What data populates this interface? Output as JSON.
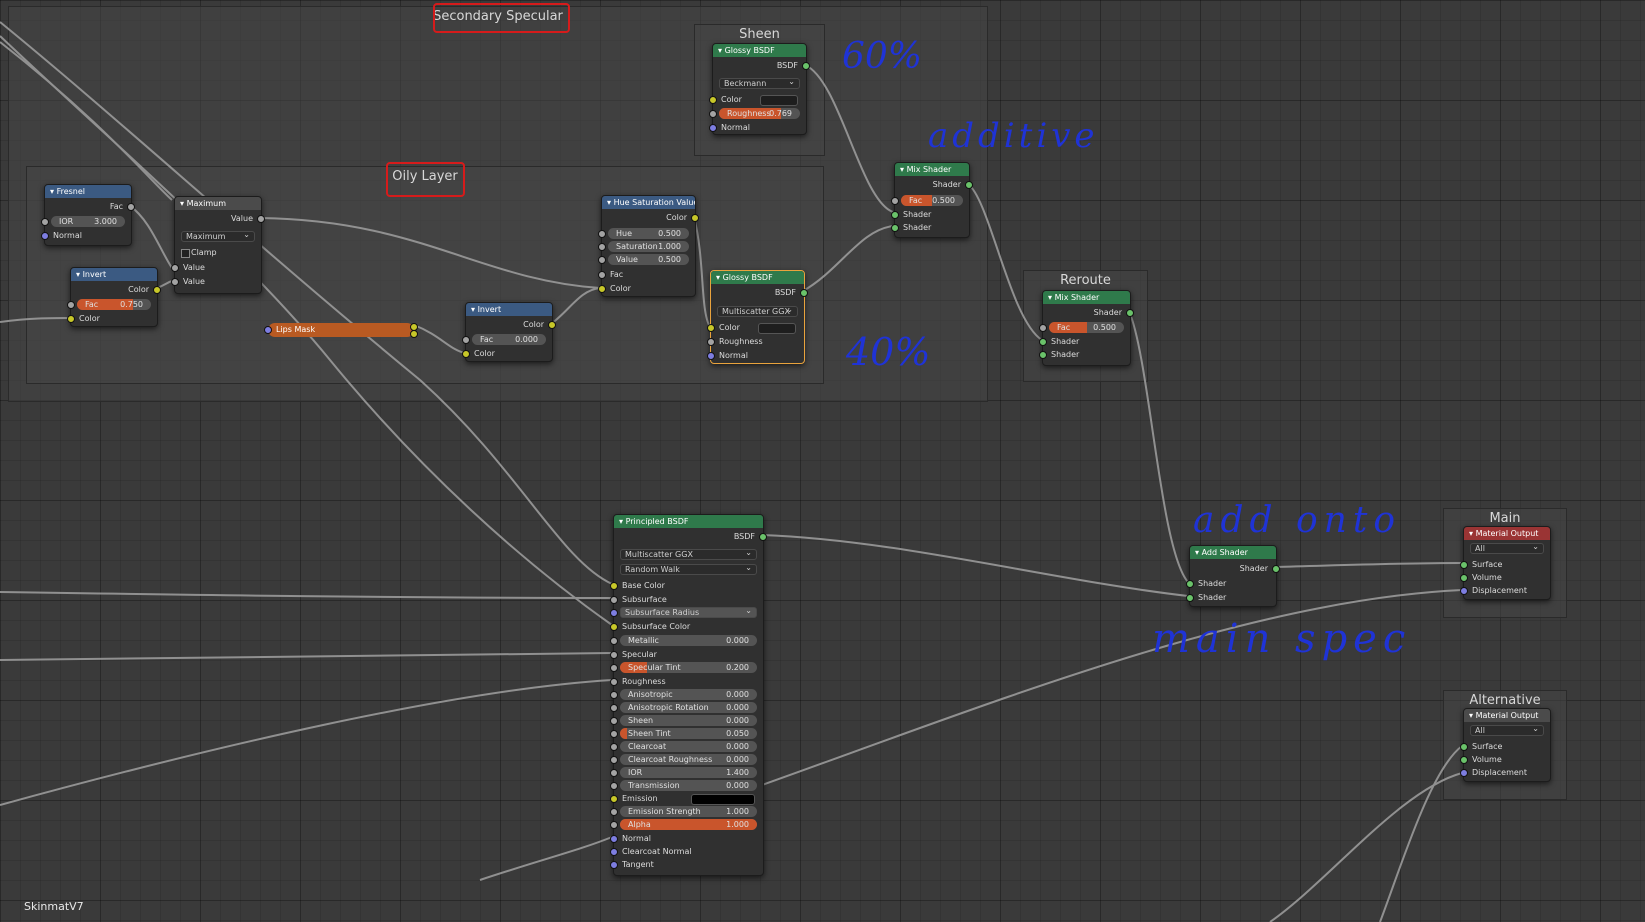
{
  "frames": {
    "secondary_specular": "Secondary Specular",
    "oily_layer": "Oily Layer",
    "sheen": "Sheen",
    "reroute": "Reroute",
    "main": "Main",
    "alternative": "Alternative"
  },
  "annotations": {
    "sixty": "60%",
    "forty": "40%",
    "additive": "additive",
    "add_onto": "add onto",
    "main_spec": "main spec"
  },
  "nodes": {
    "fresnel": {
      "title": "Fresnel",
      "fac": "Fac",
      "ior_label": "IOR",
      "ior_value": "3.000",
      "normal": "Normal"
    },
    "maximum": {
      "title": "Maximum",
      "value_out": "Value",
      "mode": "Maximum",
      "clamp": "Clamp",
      "value1": "Value",
      "value2": "Value"
    },
    "invert1": {
      "title": "Invert",
      "color_out": "Color",
      "fac_label": "Fac",
      "fac_value": "0.750",
      "color_in": "Color"
    },
    "lips_mask": {
      "title": "Lips Mask"
    },
    "invert2": {
      "title": "Invert",
      "color_out": "Color",
      "fac_label": "Fac",
      "fac_value": "0.000",
      "color_in": "Color"
    },
    "hsv": {
      "title": "Hue Saturation Value",
      "color_out": "Color",
      "hue_label": "Hue",
      "hue_value": "0.500",
      "sat_label": "Saturation",
      "sat_value": "1.000",
      "val_label": "Value",
      "val_value": "0.500",
      "fac": "Fac",
      "color_in": "Color"
    },
    "glossy_sheen": {
      "title": "Glossy BSDF",
      "bsdf": "BSDF",
      "dist": "Beckmann",
      "color": "Color",
      "rough_label": "Roughness",
      "rough_value": "0.769",
      "normal": "Normal"
    },
    "glossy_oily": {
      "title": "Glossy BSDF",
      "bsdf": "BSDF",
      "dist": "Multiscatter GGX",
      "color": "Color",
      "rough": "Roughness",
      "normal": "Normal"
    },
    "mix1": {
      "title": "Mix Shader",
      "shader_out": "Shader",
      "fac_label": "Fac",
      "fac_value": "0.500",
      "shader1": "Shader",
      "shader2": "Shader"
    },
    "mix2": {
      "title": "Mix Shader",
      "shader_out": "Shader",
      "fac_label": "Fac",
      "fac_value": "0.500",
      "shader1": "Shader",
      "shader2": "Shader"
    },
    "add_shader": {
      "title": "Add Shader",
      "shader_out": "Shader",
      "shader1": "Shader",
      "shader2": "Shader"
    },
    "output_main": {
      "title": "Material Output",
      "target": "All",
      "surface": "Surface",
      "volume": "Volume",
      "displacement": "Displacement"
    },
    "output_alt": {
      "title": "Material Output",
      "target": "All",
      "surface": "Surface",
      "volume": "Volume",
      "displacement": "Displacement"
    },
    "principled": {
      "title": "Principled BSDF",
      "bsdf": "BSDF",
      "dist": "Multiscatter GGX",
      "sss_method": "Random Walk",
      "base_color": "Base Color",
      "subsurface": "Subsurface",
      "subsurface_radius": "Subsurface Radius",
      "subsurface_color": "Subsurface Color",
      "metallic_label": "Metallic",
      "metallic_value": "0.000",
      "specular": "Specular",
      "spec_tint_label": "Specular Tint",
      "spec_tint_value": "0.200",
      "roughness": "Roughness",
      "aniso_label": "Anisotropic",
      "aniso_value": "0.000",
      "aniso_rot_label": "Anisotropic Rotation",
      "aniso_rot_value": "0.000",
      "sheen_label": "Sheen",
      "sheen_value": "0.000",
      "sheen_tint_label": "Sheen Tint",
      "sheen_tint_value": "0.050",
      "clearcoat_label": "Clearcoat",
      "clearcoat_value": "0.000",
      "cc_rough_label": "Clearcoat Roughness",
      "cc_rough_value": "0.000",
      "ior_label": "IOR",
      "ior_value": "1.400",
      "trans_label": "Transmission",
      "trans_value": "0.000",
      "emission": "Emission",
      "em_str_label": "Emission Strength",
      "em_str_value": "1.000",
      "alpha_label": "Alpha",
      "alpha_value": "1.000",
      "normal": "Normal",
      "cc_normal": "Clearcoat Normal",
      "tangent": "Tangent"
    }
  },
  "material_name": "SkinmatV7",
  "colors": {
    "accent_orange": "#c9552c",
    "shader_header": "#2f7a4b",
    "input_header": "#3b5a82",
    "output_header": "#9a3434",
    "annotation_blue": "#1f33d6",
    "selected": "#e9a33d"
  }
}
